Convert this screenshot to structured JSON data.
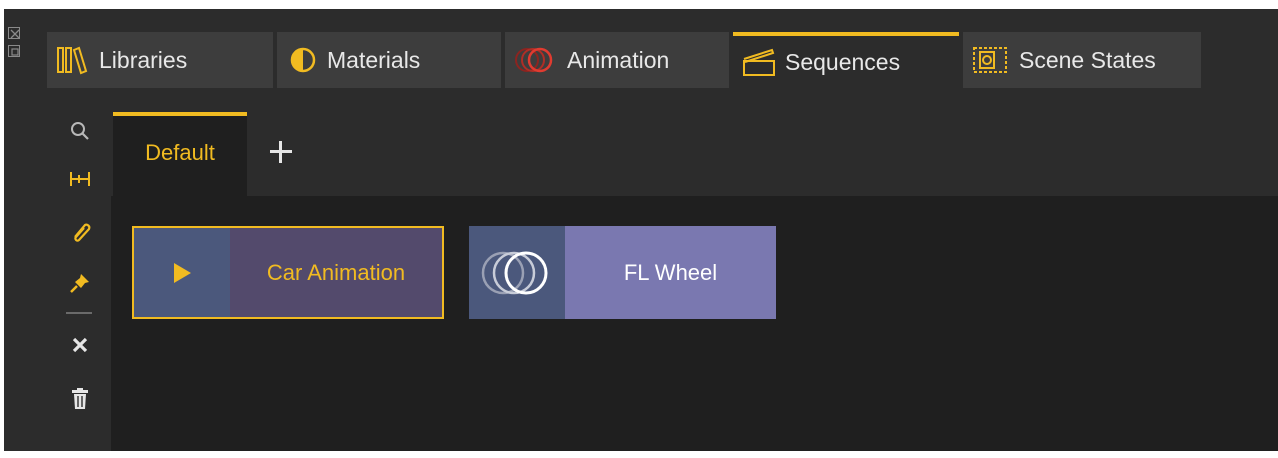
{
  "tabs": [
    {
      "label": "Libraries",
      "icon": "libraries-icon",
      "active": false
    },
    {
      "label": "Materials",
      "icon": "materials-icon",
      "active": false
    },
    {
      "label": "Animation",
      "icon": "animation-icon",
      "active": false
    },
    {
      "label": "Sequences",
      "icon": "sequences-icon",
      "active": true
    },
    {
      "label": "Scene States",
      "icon": "scene-states-icon",
      "active": false
    }
  ],
  "tools": [
    {
      "name": "search-icon"
    },
    {
      "name": "fit-icon"
    },
    {
      "name": "attach-icon"
    },
    {
      "name": "pin-icon"
    },
    {
      "name": "close-icon"
    },
    {
      "name": "trash-icon"
    }
  ],
  "subtabs": {
    "active_label": "Default",
    "add_label": "+"
  },
  "sequences": [
    {
      "label": "Car Animation",
      "icon": "play-icon",
      "selected": true
    },
    {
      "label": "FL Wheel",
      "icon": "animation-rings-icon",
      "selected": false
    }
  ],
  "colors": {
    "accent": "#f1bb21",
    "background": "#2c2c2c",
    "panel": "#1f1f1f",
    "tab": "#3d3d3d",
    "animation_red": "#d7332b"
  }
}
